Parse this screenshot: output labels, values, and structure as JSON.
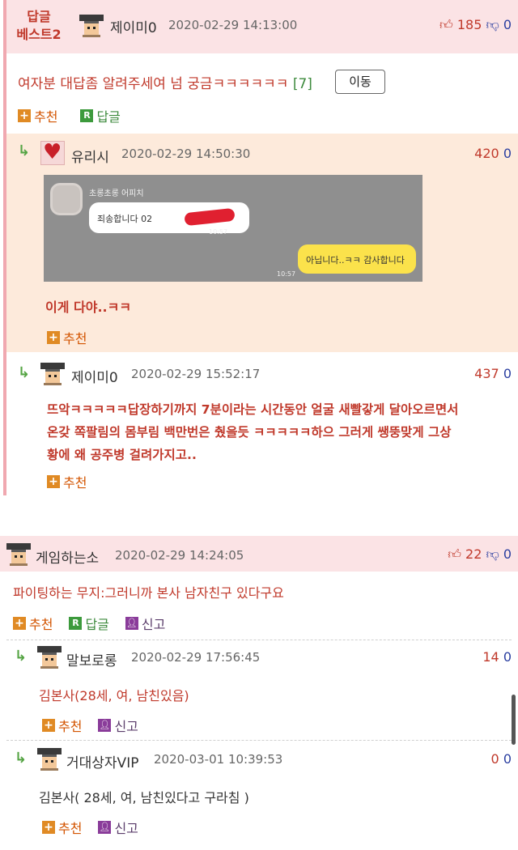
{
  "post1": {
    "badge_line1": "답글",
    "badge_line2": "베스트2",
    "nick": "제이미0",
    "date": "2020-02-29 14:13:00",
    "up": "185",
    "down": "0",
    "title": "여자분 대답좀 알려주세여 넘 궁금ㅋㅋㅋㅋㅋㅋ",
    "comment_count": "[7]",
    "move_button": "이동",
    "recommend": "추천",
    "reply": "답글",
    "replies": [
      {
        "nick": "유리시",
        "date": "2020-02-29 14:50:30",
        "score": "420",
        "zero": "0",
        "chat": {
          "sender": "초롱초롱 어피치",
          "incoming": "죄송합니다 02",
          "incoming_time": "10:57",
          "outgoing": "아닙니다..ㅋㅋ 감사합니다",
          "outgoing_time": "10:57"
        },
        "text": "이게 다야..ㅋㅋ",
        "recommend": "추천"
      },
      {
        "nick": "제이미0",
        "date": "2020-02-29 15:52:17",
        "score": "437",
        "zero": "0",
        "lines": [
          "뜨악ㅋㅋㅋㅋㅋ답장하기까지 7분이라는 시간동안 얼굴 새빨갛게 달아오르면서",
          "온갖 쪽팔림의 몸부림 백만번은 췄을듯 ㅋㅋㅋㅋㅋ하으 그러게 쌩뚱맞게 그상",
          "황에 왜 공주병 걸려가지고.."
        ],
        "recommend": "추천"
      }
    ]
  },
  "post2": {
    "nick": "게임하는소",
    "date": "2020-02-29 14:24:05",
    "up": "22",
    "down": "0",
    "title": "파이팅하는 무지:그러니까 본사 남자친구 있다구요",
    "recommend": "추천",
    "reply": "답글",
    "report": "신고",
    "replies": [
      {
        "nick": "말보로롱",
        "date": "2020-02-29 17:56:45",
        "score": "14",
        "zero": "0",
        "text": "김본사(28세, 여, 남친있음)",
        "recommend": "추천",
        "report": "신고"
      },
      {
        "nick": "거대상자VIP",
        "date": "2020-03-01 10:39:53",
        "score": "0",
        "zero": "0",
        "text": "김본사( 28세, 여, 남친있다고 구라침 )",
        "recommend": "추천",
        "report": "신고"
      }
    ]
  },
  "colors": {
    "header_bg": "#fbe3e5",
    "reply_bg": "#fdeadb",
    "accent_red": "#c0392b",
    "left_bar": "#f0a8b0"
  }
}
